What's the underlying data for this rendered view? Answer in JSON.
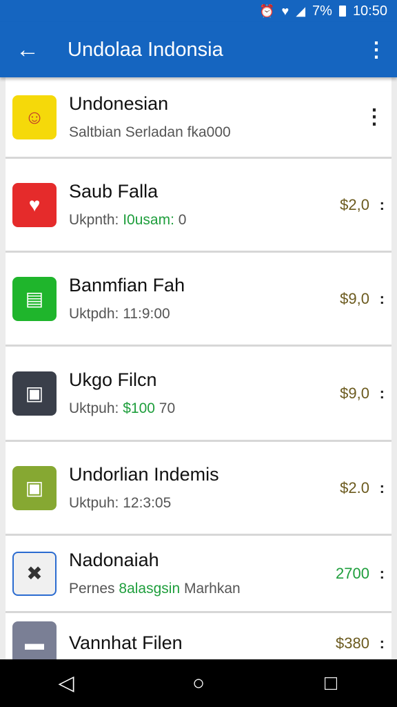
{
  "status_bar": {
    "battery": "7%",
    "time": "10:50"
  },
  "app_bar": {
    "title": "Undolaa Indonsia"
  },
  "items": [
    {
      "name": "Undonesian",
      "sub_prefix": "Saltbian Serladan fka000",
      "sub_highlight": "",
      "sub_suffix": "",
      "price": "",
      "icon_color": "#f5d90a",
      "icon_glyph": "☺",
      "price_green": false
    },
    {
      "name": "Saub Falla",
      "sub_prefix": "Ukpnth:",
      "sub_highlight": "I0usam:",
      "sub_suffix": "0",
      "price": "$2,0",
      "icon_color": "#e52b2b",
      "icon_glyph": "♥",
      "price_green": false
    },
    {
      "name": "Banmfian Fah",
      "sub_prefix": "Uktpdh: 11:9:00",
      "sub_highlight": "",
      "sub_suffix": "",
      "price": "$9,0",
      "icon_color": "#1fb52c",
      "icon_glyph": "▤",
      "price_green": false
    },
    {
      "name": "Ukgo Filcn",
      "sub_prefix": "Uktpuh:",
      "sub_highlight": "$100",
      "sub_suffix": "70",
      "price": "$9,0",
      "icon_color": "#3a3f4a",
      "icon_glyph": "▣",
      "price_green": false
    },
    {
      "name": "Undorlian Indemis",
      "sub_prefix": "Uktpuh: 12:3:05",
      "sub_highlight": "",
      "sub_suffix": "",
      "price": "$2.0",
      "icon_color": "#86a832",
      "icon_glyph": "▣",
      "price_green": false
    },
    {
      "name": "Nadonaiah",
      "sub_prefix": "Pernes",
      "sub_highlight": "8alasgsin",
      "sub_suffix": "Marhkan",
      "price": "2700",
      "icon_color": "#f0f0f0",
      "icon_glyph": "✖",
      "price_green": true
    },
    {
      "name": "Vannhat Filen",
      "sub_prefix": "",
      "sub_highlight": "",
      "sub_suffix": "",
      "price": "$380",
      "icon_color": "#7a7f95",
      "icon_glyph": "▬",
      "price_green": false
    }
  ],
  "icons": {
    "back": "back-arrow-icon",
    "more": "overflow-menu-icon",
    "nav_back": "triangle-back-icon",
    "nav_home": "circle-home-icon",
    "nav_recent": "square-recents-icon"
  },
  "colors": {
    "primary": "#1565c0",
    "accent_green": "#1e9e3c",
    "price": "#6b5a1e"
  }
}
